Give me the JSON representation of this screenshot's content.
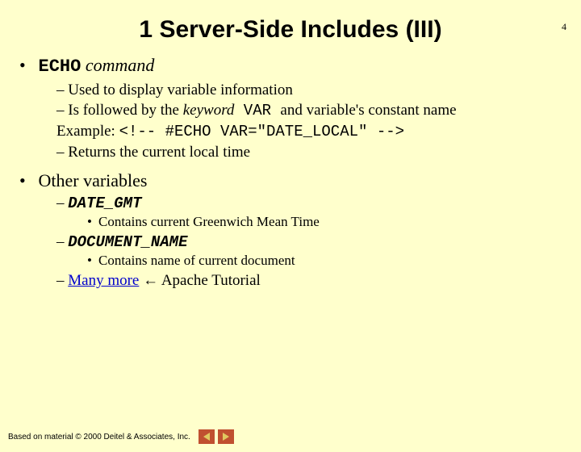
{
  "page_number": "4",
  "title": "1 Server-Side Includes (III)",
  "b1": {
    "lead_code": "ECHO",
    "lead_rest": " command",
    "sub1": "–  Used to display variable information",
    "sub2_pre": "–  Is followed by the ",
    "sub2_kw": "keyword",
    "sub2_code": " VAR ",
    "sub2_post": "and variable's constant name",
    "ex_label": "Example: ",
    "ex_code": "<!-- #ECHO VAR=\"DATE_LOCAL\" -->",
    "sub3": "–  Returns the current local time"
  },
  "b2": {
    "lead": "Other variables",
    "v1": {
      "dash": "– ",
      "name": "DATE_GMT",
      "desc": "Contains current Greenwich Mean Time"
    },
    "v2": {
      "dash": "– ",
      "name": "DOCUMENT_NAME",
      "desc": "Contains name of current document"
    },
    "more_dash": "–  ",
    "more_link": "Many more",
    "more_arrow": " ← Apache Tutorial"
  },
  "footer": "Based on material © 2000 Deitel & Associates, Inc."
}
